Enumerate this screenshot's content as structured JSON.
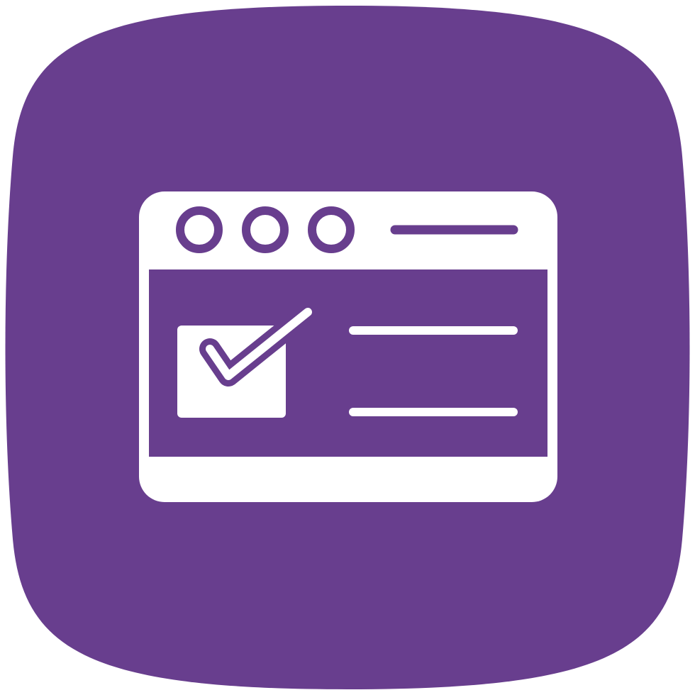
{
  "icon": {
    "name": "browser-checklist-icon",
    "colors": {
      "tile": "#683e8e",
      "glyph": "#ffffff",
      "page_background": "#ffffff"
    },
    "window_controls": [
      "circle",
      "circle",
      "circle"
    ],
    "checkbox_checked": true,
    "content_lines": 2
  }
}
